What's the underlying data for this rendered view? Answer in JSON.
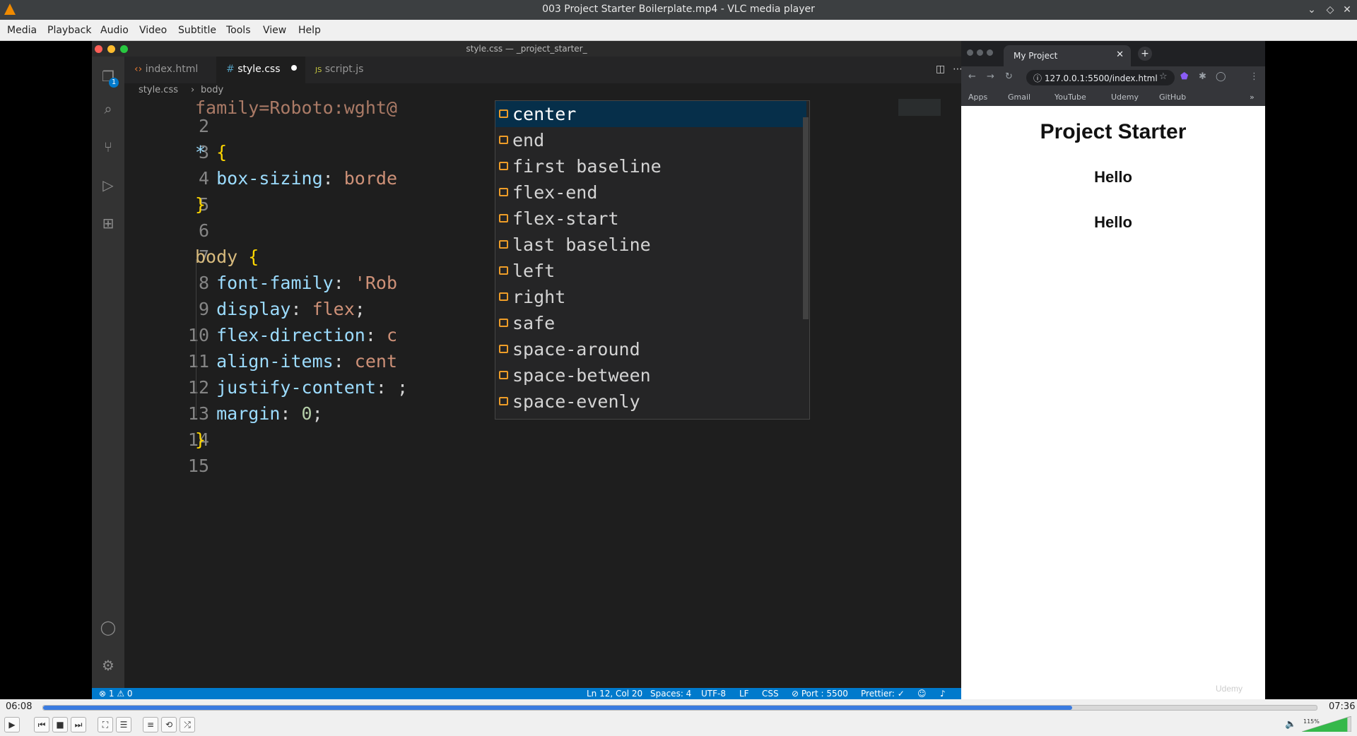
{
  "vlc": {
    "window_title": "003 Project Starter Boilerplate.mp4 - VLC media player",
    "menu": [
      "Media",
      "Playback",
      "Audio",
      "Video",
      "Subtitle",
      "Tools",
      "View",
      "Help"
    ],
    "time_elapsed": "06:08",
    "time_total": "07:36",
    "progress": 0.808,
    "volume_label": "115%",
    "volume_level": 1.15
  },
  "vscode": {
    "window_title": "style.css — _project_starter_",
    "tabs": [
      {
        "label": "index.html",
        "icon": "<>"
      },
      {
        "label": "style.css",
        "icon": "#"
      },
      {
        "label": "script.js",
        "icon": "JS"
      }
    ],
    "breadcrumb": [
      "style.css",
      "body"
    ],
    "badge": "1",
    "line_numbers": [
      "2",
      "3",
      "4",
      "5",
      "6",
      "7",
      "8",
      "9",
      "10",
      "11",
      "12",
      "13",
      "14",
      "15"
    ],
    "partial_first_line": "family=Roboto:wght@",
    "suggestions": [
      "center",
      "end",
      "first baseline",
      "flex-end",
      "flex-start",
      "last baseline",
      "left",
      "right",
      "safe",
      "space-around",
      "space-between",
      "space-evenly"
    ],
    "status": {
      "problems": "⊗ 1 ⚠ 0",
      "position": "Ln 12, Col 20",
      "spaces": "Spaces: 4",
      "encoding": "UTF-8",
      "eol": "LF",
      "language": "CSS",
      "port": "⊘ Port : 5500",
      "prettier": "Prettier: ✓"
    }
  },
  "browser": {
    "tab_title": "My Project",
    "url": "127.0.0.1:5500/index.html",
    "bookmarks": [
      "Apps",
      "Gmail",
      "YouTube",
      "Udemy",
      "GitHub"
    ],
    "page_heading": "Project Starter",
    "page_items": [
      "Hello",
      "Hello"
    ],
    "watermark": "Udemy"
  }
}
